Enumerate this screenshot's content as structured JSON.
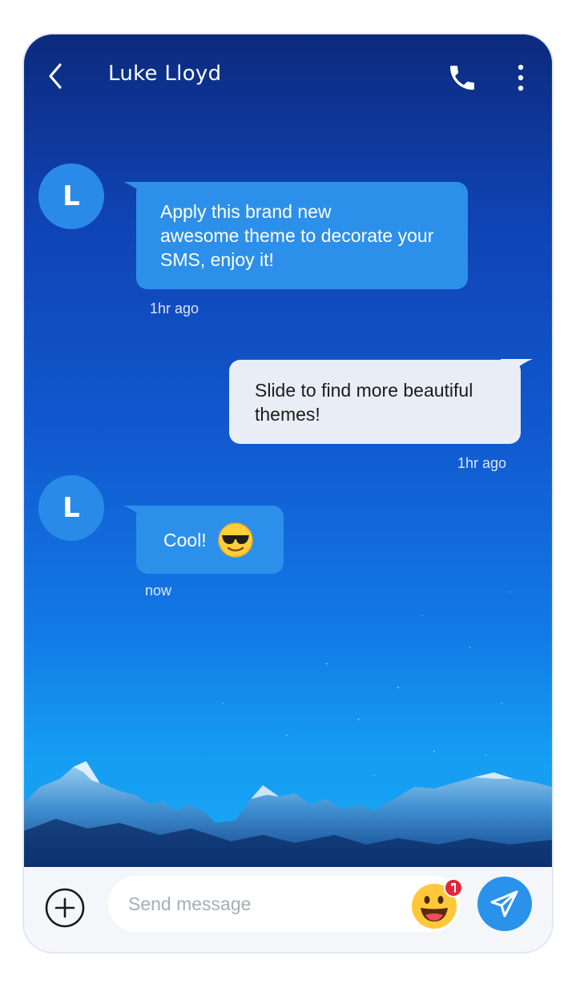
{
  "header": {
    "contact_name": "Luke Lloyd",
    "back_icon": "chevron-left-icon",
    "call_icon": "phone-icon",
    "more_icon": "more-vertical-icon"
  },
  "messages": [
    {
      "direction": "incoming",
      "avatar_initial": "L",
      "text_lines": [
        "Apply this brand new",
        "awesome theme to decorate your",
        "SMS, enjoy it!"
      ],
      "timestamp": "1hr ago"
    },
    {
      "direction": "outgoing",
      "text_lines": [
        "Slide to find more beautiful",
        "themes!"
      ],
      "timestamp": "1hr ago"
    },
    {
      "direction": "incoming",
      "avatar_initial": "L",
      "text": "Cool!",
      "emoji": "sunglasses-face-emoji",
      "timestamp": "now"
    }
  ],
  "composer": {
    "placeholder": "Send message",
    "add_icon": "plus-circle-icon",
    "emoji_icon": "grinning-face-emoji",
    "send_icon": "paper-plane-icon"
  },
  "colors": {
    "incoming_bubble": "#2c90ea",
    "outgoing_bubble": "#e9edf5",
    "avatar": "#2a8ae8",
    "send_button": "#2b92ec"
  }
}
